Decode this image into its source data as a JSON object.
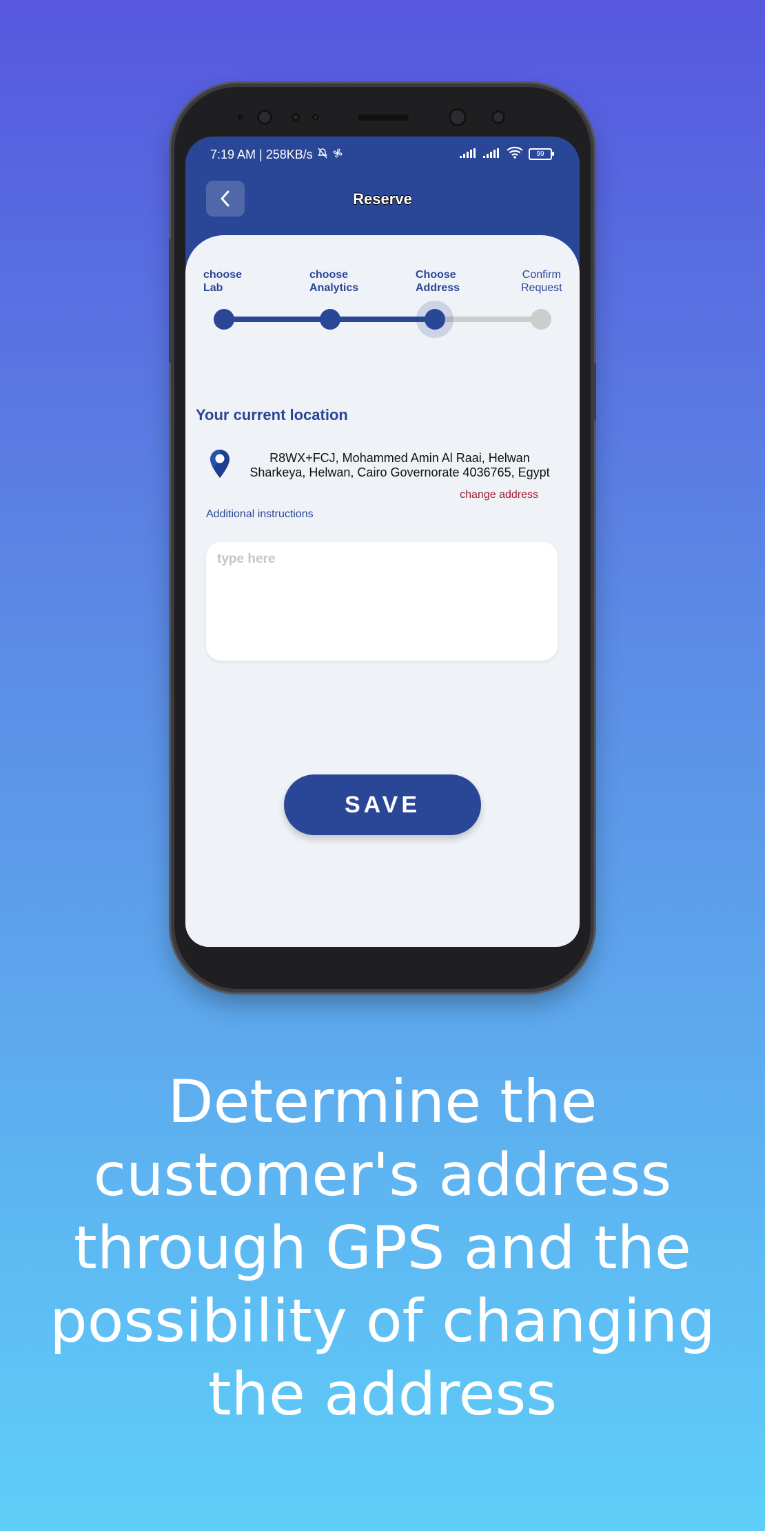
{
  "status_bar": {
    "time_speed": "7:19 AM | 258KB/s",
    "battery": "99"
  },
  "header": {
    "title": "Reserve"
  },
  "steps": [
    {
      "line1": "choose",
      "line2": "Lab",
      "state": "done"
    },
    {
      "line1": "choose",
      "line2": "Analytics",
      "state": "done"
    },
    {
      "line1": "Choose",
      "line2": "Address",
      "state": "current"
    },
    {
      "line1": "Confirm",
      "line2": "Request",
      "state": "pending"
    }
  ],
  "location": {
    "title": "Your current location",
    "address": "R8WX+FCJ, Mohammed Amin Al Raai, Helwan Sharkeya, Helwan, Cairo Governorate 4036765, Egypt",
    "change_link": "change address"
  },
  "instructions": {
    "label": "Additional instructions",
    "placeholder": "type here",
    "value": ""
  },
  "save_button": "SAVE",
  "caption": "Determine the customer's address through GPS and the possibility of changing the address",
  "colors": {
    "primary": "#2a4697",
    "link_red": "#a31b2e",
    "sheet_bg": "#eff2f7",
    "inactive": "#cdcdcd"
  }
}
